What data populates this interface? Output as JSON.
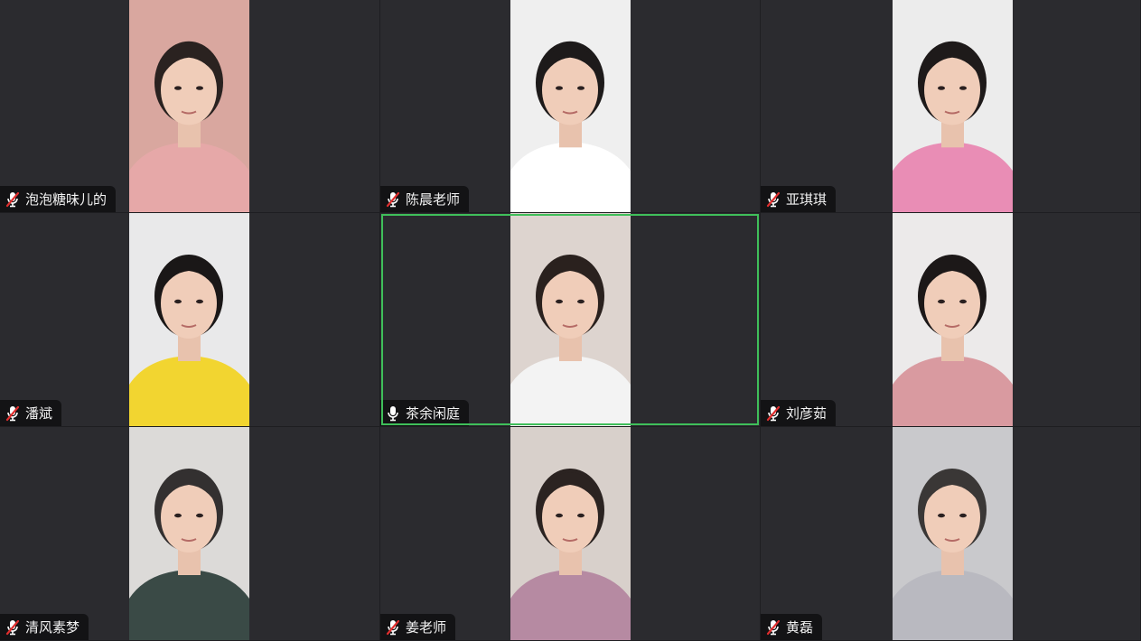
{
  "participants": [
    {
      "name": "泡泡糖味儿的",
      "muted": true,
      "active": false,
      "bg": "#d9a79f",
      "shirt": "#e6a8a8",
      "hair": "#2a2220"
    },
    {
      "name": "陈晨老师",
      "muted": true,
      "active": false,
      "bg": "#efefef",
      "shirt": "#ffffff",
      "hair": "#1d1a1a"
    },
    {
      "name": "亚琪琪",
      "muted": true,
      "active": false,
      "bg": "#ececec",
      "shirt": "#e98db5",
      "hair": "#1e1a1a"
    },
    {
      "name": "潘斌",
      "muted": true,
      "active": false,
      "bg": "#e9e9ea",
      "shirt": "#f2d530",
      "hair": "#1a1717"
    },
    {
      "name": "茶余闲庭",
      "muted": false,
      "active": true,
      "bg": "#ddd4cf",
      "shirt": "#f3f3f3",
      "hair": "#2a211e"
    },
    {
      "name": "刘彦茹",
      "muted": true,
      "active": false,
      "bg": "#eceaea",
      "shirt": "#d99aa0",
      "hair": "#1c1818"
    },
    {
      "name": "清风素梦",
      "muted": true,
      "active": false,
      "bg": "#dcdad8",
      "shirt": "#3a4a46",
      "hair": "#333030"
    },
    {
      "name": "姜老师",
      "muted": true,
      "active": false,
      "bg": "#d8d0cb",
      "shirt": "#b68aa2",
      "hair": "#2b2321"
    },
    {
      "name": "黄磊",
      "muted": true,
      "active": false,
      "bg": "#c9c9cc",
      "shirt": "#b9b9c0",
      "hair": "#3a3736"
    }
  ],
  "colors": {
    "active_border": "#3fbf5a",
    "tile_bg": "#2b2b2f",
    "muted_mic": "#e02e2e",
    "label_text": "#f2f2f2"
  },
  "icons": {
    "muted": "mic-muted-icon",
    "unmuted": "mic-icon"
  }
}
